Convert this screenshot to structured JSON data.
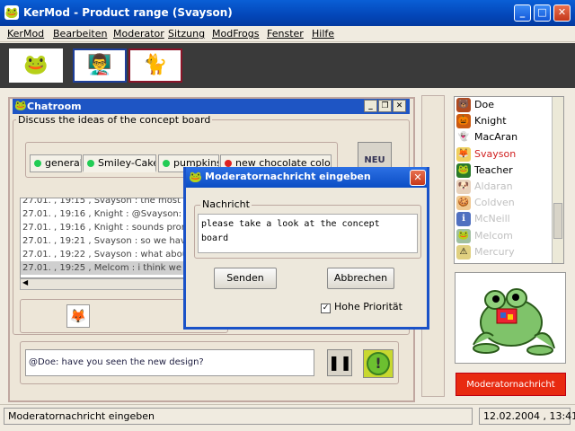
{
  "window": {
    "title": "KerMod - Product range (Svayson)"
  },
  "menu": [
    "KerMod",
    "Bearbeiten",
    "Moderator",
    "Sitzung",
    "ModFrogs",
    "Fenster",
    "Hilfe"
  ],
  "chatroom": {
    "title": "Chatroom",
    "topic": "Discuss the ideas of the concept board",
    "new_button": "NEU",
    "tabs": [
      {
        "label": "general",
        "color": "#22cc55"
      },
      {
        "label": "Smiley-Cake",
        "color": "#22cc55"
      },
      {
        "label": "pumpkins",
        "color": "#22cc55"
      },
      {
        "label": "new chocolate colors",
        "color": "#dd2222"
      }
    ],
    "messages": [
      "27.01. , 19:15 , Svayson : the most p",
      "27.01. , 19:16 , Knight : @Svayson: a",
      "27.01. , 19:16 , Knight : sounds prom",
      "27.01. , 19:21 , Svayson : so we have",
      "27.01. , 19:22 , Svayson : what about",
      "27.01. , 19:25 , Melcom : i think we s"
    ],
    "input_value": "@Doe: have you seen the new design?"
  },
  "users": [
    {
      "name": "Doe",
      "color": "#b04a20",
      "active": true
    },
    {
      "name": "Knight",
      "color": "#cc5a10",
      "active": true
    },
    {
      "name": "MacAran",
      "color": "#555555",
      "active": true
    },
    {
      "name": "Svayson",
      "color": "#d06010",
      "active": true,
      "highlight": true
    },
    {
      "name": "Teacher",
      "color": "#2a7a2a",
      "active": true
    },
    {
      "name": "Aldaran",
      "color": "#c89060",
      "active": false
    },
    {
      "name": "Coldven",
      "color": "#e0a030",
      "active": false
    },
    {
      "name": "McNeill",
      "color": "#3050b0",
      "active": false
    },
    {
      "name": "Melcom",
      "color": "#70a070",
      "active": false
    },
    {
      "name": "Mercury",
      "color": "#c0b040",
      "active": false
    }
  ],
  "moderator_button": "Moderatornachricht",
  "status": {
    "left": "Moderatornachricht eingeben",
    "right": "12.02.2004 , 13:41"
  },
  "dialog": {
    "title": "Moderatornachricht eingeben",
    "group_label": "Nachricht",
    "text_line1": "please take a look at the concept",
    "text_line2": "board",
    "send": "Senden",
    "cancel": "Abbrechen",
    "priority_label": "Hohe Priorität",
    "priority_checked": true
  }
}
